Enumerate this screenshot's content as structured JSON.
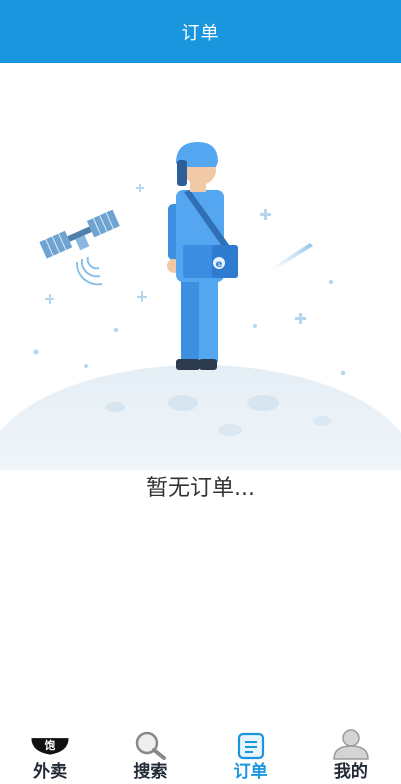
{
  "header": {
    "title": "订单"
  },
  "empty_state": {
    "message": "暂无订单...",
    "illustration": "courier-on-moon-illustration"
  },
  "tabbar": {
    "active_index": 2,
    "items": [
      {
        "label": "外卖",
        "icon": "eleme-logo-icon",
        "logo_text": "饱"
      },
      {
        "label": "搜索",
        "icon": "search-icon"
      },
      {
        "label": "订单",
        "icon": "order-list-icon"
      },
      {
        "label": "我的",
        "icon": "user-icon"
      }
    ]
  },
  "colors": {
    "brand": "#1a96de",
    "text_dark": "#222b36",
    "text_body": "#333333"
  }
}
